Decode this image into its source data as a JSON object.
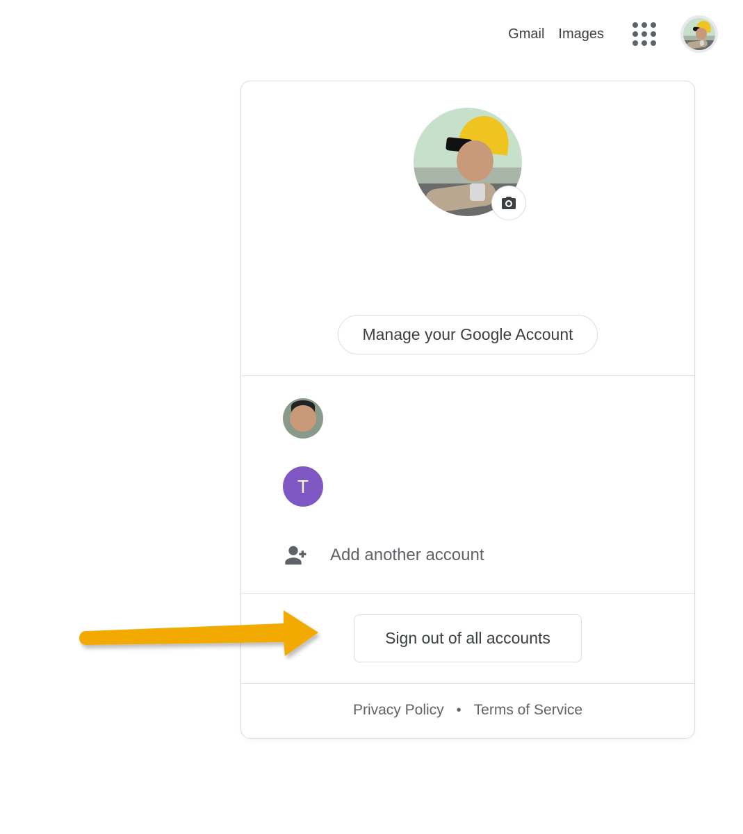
{
  "header": {
    "gmail": "Gmail",
    "images": "Images"
  },
  "popover": {
    "manage_label": "Manage your Google Account",
    "other_accounts": [
      {
        "type": "photo"
      },
      {
        "type": "initial",
        "initial": "T",
        "color": "purple"
      }
    ],
    "add_account_label": "Add another account",
    "sign_out_label": "Sign out of all accounts",
    "footer": {
      "privacy": "Privacy Policy",
      "terms": "Terms of Service"
    }
  },
  "annotation": {
    "arrow_color": "#f2a900"
  }
}
